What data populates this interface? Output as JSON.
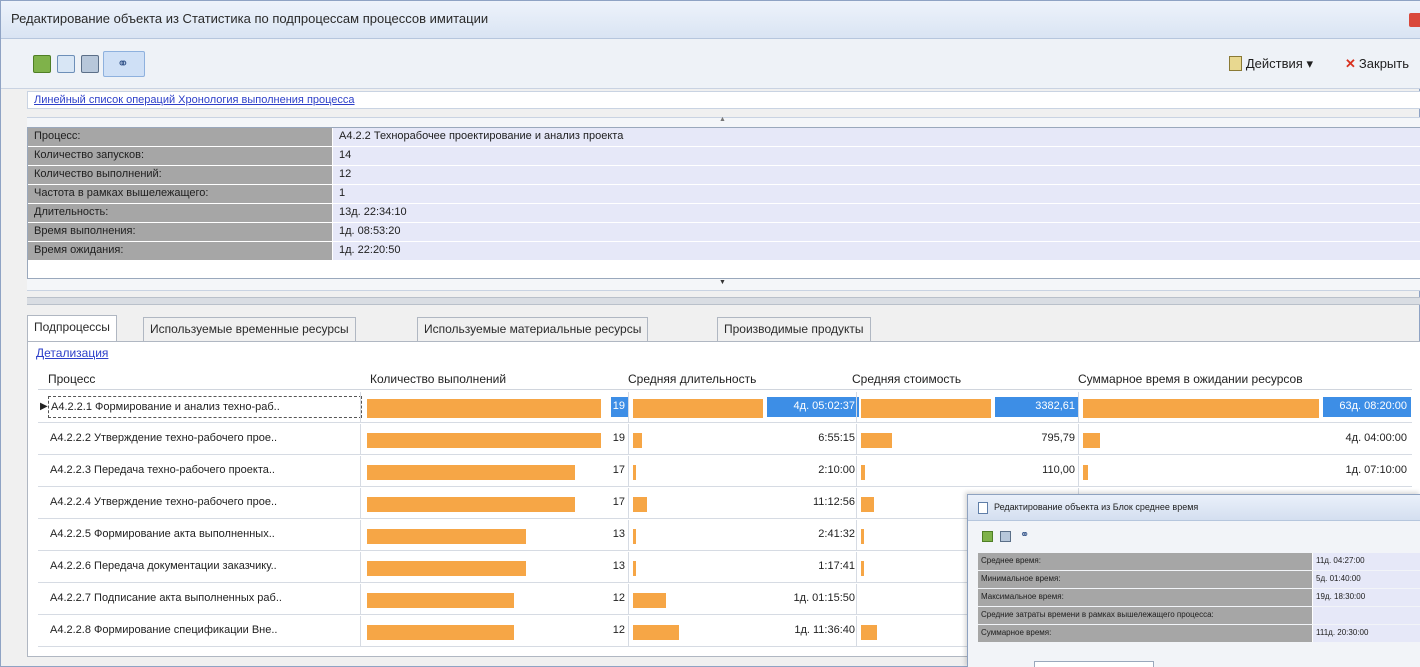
{
  "window": {
    "title": "Редактирование объекта  из Статистика по подпроцессам процессов имитации"
  },
  "toolbar": {
    "actions_label": "Действия",
    "close_label": "Закрыть"
  },
  "linkbar": {
    "text": "Линейный список операций Хронология выполнения процесса"
  },
  "properties": [
    {
      "label": "Процесс:",
      "value": "А4.2.2 Технорабочее проектирование и анализ проекта"
    },
    {
      "label": "Количество запусков:",
      "value": "14"
    },
    {
      "label": "Количество выполнений:",
      "value": "12"
    },
    {
      "label": "Частота в рамках вышележащего:",
      "value": "1"
    },
    {
      "label": "Длительность:",
      "value": "13д. 22:34:10"
    },
    {
      "label": "Время выполнения:",
      "value": "1д. 08:53:20"
    },
    {
      "label": "Время ожидания:",
      "value": "1д. 22:20:50"
    }
  ],
  "tabs": [
    {
      "label": "Подпроцессы"
    },
    {
      "label": "Используемые временные ресурсы"
    },
    {
      "label": "Используемые материальные ресурсы"
    },
    {
      "label": "Производимые продукты"
    }
  ],
  "detail_link": "Детализация",
  "grid": {
    "columns": [
      "Процесс",
      "Количество выполнений",
      "Средняя длительность",
      "Средняя стоимость",
      "Суммарное время в ожидании ресурсов"
    ],
    "rows": [
      {
        "name": "А4.2.2.1 Формирование и анализ техно-раб..",
        "count": "19",
        "count_frac": 1.0,
        "dur": "4д. 05:02:37",
        "dur_frac": 1.0,
        "cost": "3382,61",
        "cost_frac": 1.0,
        "wait": "63д. 08:20:00",
        "wait_frac": 1.0
      },
      {
        "name": "А4.2.2.2 Утверждение техно-рабочего прое..",
        "count": "19",
        "count_frac": 1.0,
        "dur": "6:55:15",
        "dur_frac": 0.07,
        "cost": "795,79",
        "cost_frac": 0.24,
        "wait": "4д. 04:00:00",
        "wait_frac": 0.07
      },
      {
        "name": "А4.2.2.3 Передача техно-рабочего проекта..",
        "count": "17",
        "count_frac": 0.89,
        "dur": "2:10:00",
        "dur_frac": 0.02,
        "cost": "110,00",
        "cost_frac": 0.03,
        "wait": "1д. 07:10:00",
        "wait_frac": 0.02
      },
      {
        "name": "А4.2.2.4 Утверждение техно-рабочего прое..",
        "count": "17",
        "count_frac": 0.89,
        "dur": "11:12:56",
        "dur_frac": 0.11,
        "cost": "",
        "cost_frac": 0.1,
        "wait": "",
        "wait_frac": 0
      },
      {
        "name": "А4.2.2.5 Формирование акта выполненных..",
        "count": "13",
        "count_frac": 0.68,
        "dur": "2:41:32",
        "dur_frac": 0.02,
        "cost": "",
        "cost_frac": 0.01,
        "wait": "",
        "wait_frac": 0
      },
      {
        "name": "А4.2.2.6 Передача документации заказчику..",
        "count": "13",
        "count_frac": 0.68,
        "dur": "1:17:41",
        "dur_frac": 0.01,
        "cost": "",
        "cost_frac": 0.01,
        "wait": "",
        "wait_frac": 0
      },
      {
        "name": "А4.2.2.7 Подписание акта выполненных раб..",
        "count": "12",
        "count_frac": 0.63,
        "dur": "1д. 01:15:50",
        "dur_frac": 0.25,
        "cost": "",
        "cost_frac": 0,
        "wait": "",
        "wait_frac": 0
      },
      {
        "name": "А4.2.2.8 Формирование спецификации Вне..",
        "count": "12",
        "count_frac": 0.63,
        "dur": "1д. 11:36:40",
        "dur_frac": 0.35,
        "cost": "",
        "cost_frac": 0.12,
        "wait": "",
        "wait_frac": 0
      }
    ]
  },
  "popup": {
    "title": "Редактирование объекта  из Блок среднее время",
    "rows": [
      {
        "label": "Среднее время:",
        "value": "11д. 04:27:00"
      },
      {
        "label": "Минимальное время:",
        "value": "5д. 01:40:00"
      },
      {
        "label": "Максимальное время:",
        "value": "19д. 18:30:00"
      },
      {
        "label": "Средние затраты времени в рамках вышележащего процесса:",
        "value": ""
      },
      {
        "label": "Суммарное время:",
        "value": "111д. 20:30:00"
      }
    ]
  },
  "colors": {
    "bar": "#f6a646",
    "selection": "#3d8ee6",
    "label_bg": "#a6a6a6",
    "value_bg": "#e6e8f8",
    "link": "#2d3fc9"
  }
}
